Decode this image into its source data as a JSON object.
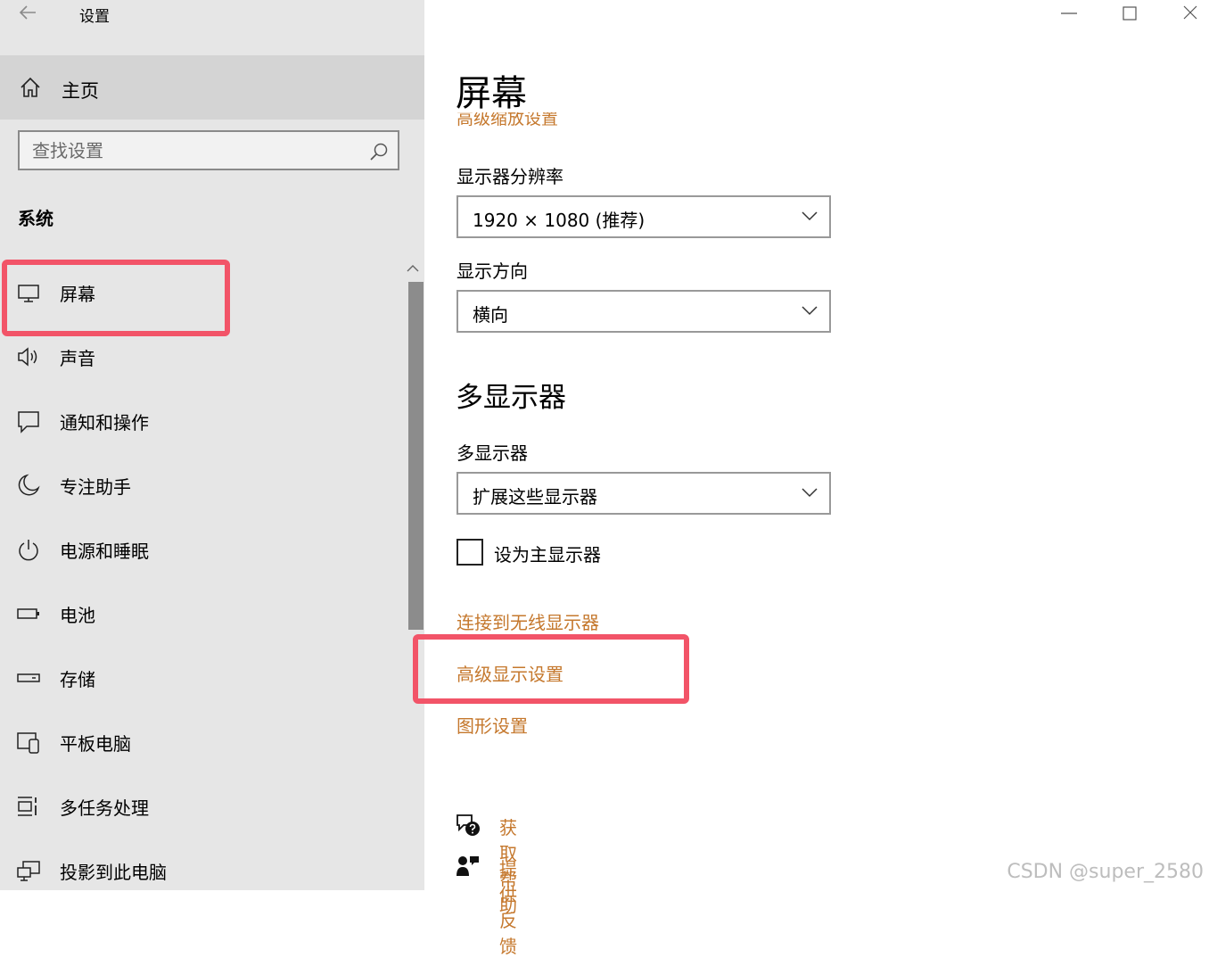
{
  "window": {
    "title": "设置",
    "controls": [
      "minimize-icon",
      "maximize-icon",
      "close-icon"
    ]
  },
  "sidebar": {
    "home_label": "主页",
    "search_placeholder": "查找设置",
    "section_title": "系统",
    "items": [
      {
        "label": "屏幕",
        "icon": "monitor-icon",
        "selected": true
      },
      {
        "label": "声音",
        "icon": "speaker-icon"
      },
      {
        "label": "通知和操作",
        "icon": "notification-icon"
      },
      {
        "label": "专注助手",
        "icon": "moon-icon"
      },
      {
        "label": "电源和睡眠",
        "icon": "power-icon"
      },
      {
        "label": "电池",
        "icon": "battery-icon"
      },
      {
        "label": "存储",
        "icon": "storage-icon"
      },
      {
        "label": "平板电脑",
        "icon": "tablet-icon"
      },
      {
        "label": "多任务处理",
        "icon": "multitask-icon"
      },
      {
        "label": "投影到此电脑",
        "icon": "project-icon"
      }
    ]
  },
  "main": {
    "page_title": "屏幕",
    "cut_link": "高级缩放设置",
    "resolution": {
      "label": "显示器分辨率",
      "value": "1920 × 1080 (推荐)"
    },
    "orientation": {
      "label": "显示方向",
      "value": "横向"
    },
    "multi_display": {
      "title": "多显示器",
      "label": "多显示器",
      "value": "扩展这些显示器",
      "checkbox_label": "设为主显示器",
      "checked": false
    },
    "links": [
      "连接到无线显示器",
      "高级显示设置",
      "图形设置"
    ],
    "help": {
      "get_help": "获取帮助",
      "feedback": "提供反馈"
    }
  },
  "colors": {
    "accent_link": "#c5782d",
    "highlight_box": "#f25468",
    "sidebar_bg": "#e6e6e6",
    "home_row_bg": "#d4d4d4"
  },
  "watermark": "CSDN @super_2580"
}
